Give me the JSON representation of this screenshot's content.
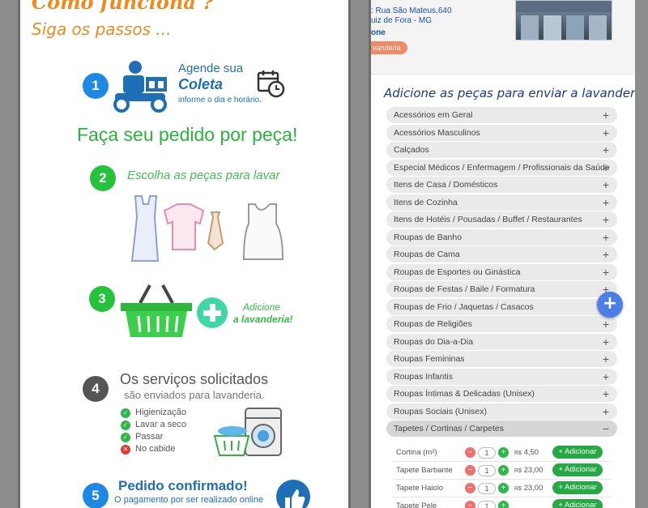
{
  "left": {
    "heading": "Como funciona ?",
    "subheading": "Siga os passos ...",
    "step1": {
      "number": "1",
      "line1": "Agende sua",
      "line2": "Coleta",
      "line3": "informe o dia e horário."
    },
    "order_by_piece": "Faça seu pedido por peça!",
    "step2": {
      "number": "2",
      "text": "Escolha as peças para lavar"
    },
    "step3": {
      "number": "3",
      "line1": "Adicione",
      "line2": "a lavanderia!"
    },
    "step4": {
      "number": "4",
      "title": "Os serviços solicitados",
      "subtitle": "são enviados para lavanderia.",
      "checks": [
        {
          "label": "Higienização",
          "ok": true
        },
        {
          "label": "Lavar a seco",
          "ok": true
        },
        {
          "label": "Passar",
          "ok": true
        },
        {
          "label": "No cabide",
          "ok": false
        }
      ]
    },
    "step5": {
      "number": "5",
      "title": "Pedido confirmado!",
      "subtitle": "O pagamento por ser realizado online"
    }
  },
  "right": {
    "address_line1": ": Rua São Mateus,640",
    "address_line2": "uiz de Fora - MG",
    "phone_label": "one",
    "badge": "vanderia",
    "section_title": "Adicione as peças para enviar a lavanderia",
    "categories": [
      {
        "label": "Acessórios em Geral",
        "state": "+"
      },
      {
        "label": "Acessórios Masculinos",
        "state": "+"
      },
      {
        "label": "Calçados",
        "state": "+"
      },
      {
        "label": "Especial Médicos / Enfermagem / Profissionais da Saúde",
        "state": "+"
      },
      {
        "label": "Itens de Casa / Domésticos",
        "state": "+"
      },
      {
        "label": "Itens de Cozinha",
        "state": "+"
      },
      {
        "label": "Itens de Hotéis / Pousadas / Buffet / Restaurantes",
        "state": "+"
      },
      {
        "label": "Roupas de Banho",
        "state": "+"
      },
      {
        "label": "Roupas de Cama",
        "state": "+"
      },
      {
        "label": "Roupas de Esportes ou Ginástica",
        "state": "+"
      },
      {
        "label": "Roupas de Festas / Baile / Formatura",
        "state": "+"
      },
      {
        "label": "Roupas de Frio / Jaquetas / Casacos",
        "state": "+"
      },
      {
        "label": "Roupas de Religiões",
        "state": "+"
      },
      {
        "label": "Roupas do Dia-a-Dia",
        "state": "+"
      },
      {
        "label": "Roupas Femininas",
        "state": "+"
      },
      {
        "label": "Roupas Infantis",
        "state": "+"
      },
      {
        "label": "Roupas Íntimas & Delicadas (Unisex)",
        "state": "+"
      },
      {
        "label": "Roupas Sociais (Unisex)",
        "state": "+"
      },
      {
        "label": "Tapetes / Cortinas / Carpetes",
        "state": "−"
      }
    ],
    "items": [
      {
        "name": "Cortina (m²)",
        "qty": "1",
        "currency": "R$",
        "price": "4,50",
        "button": "Adicionar"
      },
      {
        "name": "Tapete Barbante",
        "qty": "1",
        "currency": "R$",
        "price": "23,00",
        "button": "Adicionar"
      },
      {
        "name": "Tapete Haiolo",
        "qty": "1",
        "currency": "R$",
        "price": "23,00",
        "button": "Adicionar"
      },
      {
        "name": "Tapete Pele",
        "qty": "1",
        "currency": "R$",
        "price": "",
        "button": "Adicionar"
      }
    ],
    "minus_symbol": "−",
    "plus_symbol": "+",
    "add_prefix": "+",
    "fab_symbol": "+"
  }
}
